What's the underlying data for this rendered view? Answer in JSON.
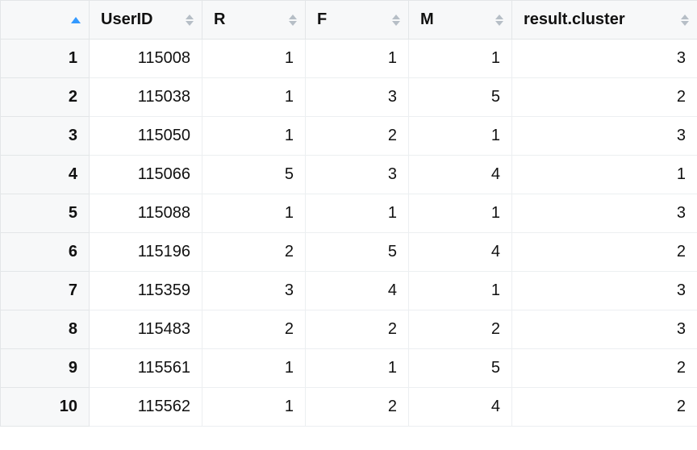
{
  "table": {
    "columns": {
      "index": "",
      "userid": "UserID",
      "r": "R",
      "f": "F",
      "m": "M",
      "cluster": "result.cluster"
    },
    "rows": [
      {
        "idx": "1",
        "userid": "115008",
        "r": "1",
        "f": "1",
        "m": "1",
        "cluster": "3"
      },
      {
        "idx": "2",
        "userid": "115038",
        "r": "1",
        "f": "3",
        "m": "5",
        "cluster": "2"
      },
      {
        "idx": "3",
        "userid": "115050",
        "r": "1",
        "f": "2",
        "m": "1",
        "cluster": "3"
      },
      {
        "idx": "4",
        "userid": "115066",
        "r": "5",
        "f": "3",
        "m": "4",
        "cluster": "1"
      },
      {
        "idx": "5",
        "userid": "115088",
        "r": "1",
        "f": "1",
        "m": "1",
        "cluster": "3"
      },
      {
        "idx": "6",
        "userid": "115196",
        "r": "2",
        "f": "5",
        "m": "4",
        "cluster": "2"
      },
      {
        "idx": "7",
        "userid": "115359",
        "r": "3",
        "f": "4",
        "m": "1",
        "cluster": "3"
      },
      {
        "idx": "8",
        "userid": "115483",
        "r": "2",
        "f": "2",
        "m": "2",
        "cluster": "3"
      },
      {
        "idx": "9",
        "userid": "115561",
        "r": "1",
        "f": "1",
        "m": "5",
        "cluster": "2"
      },
      {
        "idx": "10",
        "userid": "115562",
        "r": "1",
        "f": "2",
        "m": "4",
        "cluster": "2"
      }
    ]
  },
  "colors": {
    "sort_active": "#3399ff",
    "sort_inactive": "#b6bec6"
  }
}
